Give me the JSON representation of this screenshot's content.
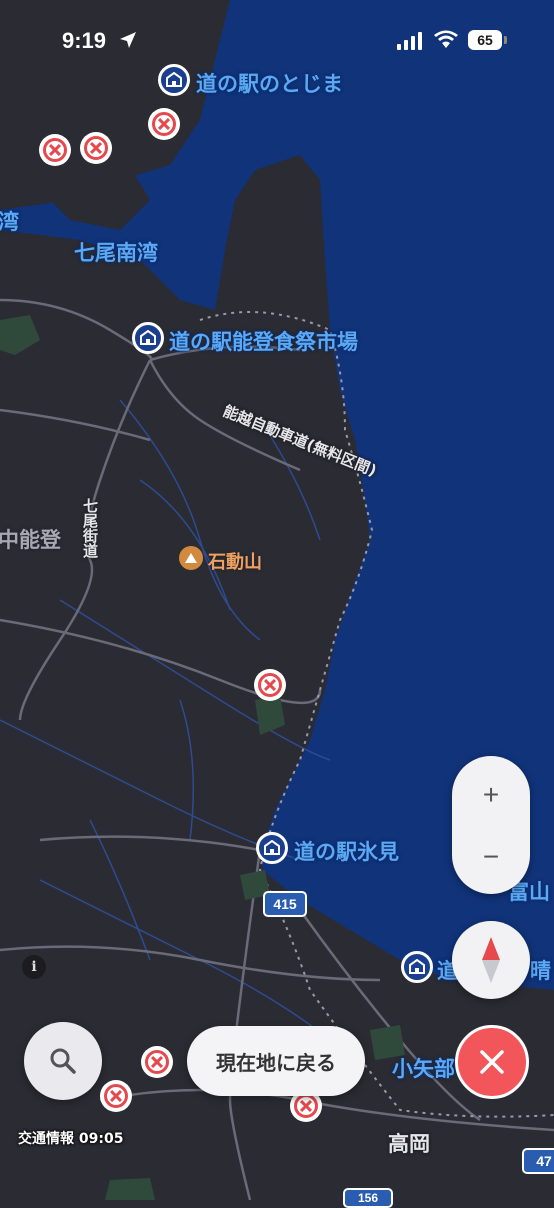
{
  "status_bar": {
    "time": "9:19",
    "battery": "65"
  },
  "map": {
    "station_labels": [
      "道の駅のとじま",
      "道の駅能登食祭市場",
      "道の駅氷見",
      "道"
    ],
    "place_labels": {
      "nanao_south_bay": "七尾南湾",
      "bay_partial": "湾",
      "naka_noto": "中能登",
      "nanao_kaido": "七尾街道",
      "sekidozan": "石動山",
      "toyama_partial": "富山",
      "clear_partial": "晴",
      "oyabe_partial": "小矢部",
      "takaoka": "高岡",
      "expressway": "能越自動車道(無料区間)"
    },
    "route_shields": [
      "415",
      "47",
      "156"
    ],
    "colors": {
      "sea": "#10337a",
      "land": "#2b2b33",
      "station_label": "#5ba8f5",
      "closure": "#e5484d",
      "close_button": "#f2555a"
    }
  },
  "controls": {
    "zoom_in": "+",
    "zoom_out": "−",
    "return_to_location": "現在地に戻る",
    "traffic_info": "交通情報 09:05",
    "info": "i"
  }
}
